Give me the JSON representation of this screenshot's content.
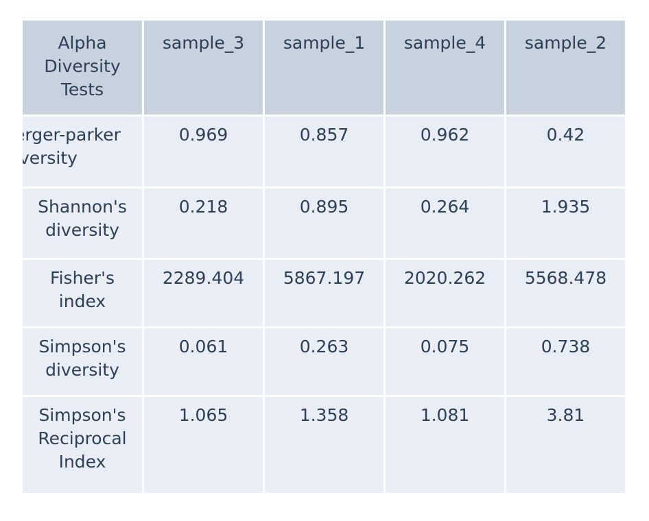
{
  "table": {
    "corner_header": "Alpha Diversity Tests",
    "columns": [
      "sample_3",
      "sample_1",
      "sample_4",
      "sample_2"
    ],
    "rows": [
      {
        "label": "berger-parker diversity",
        "label_rendered": "erger-parker iversity",
        "clipped": true,
        "values": [
          "0.969",
          "0.857",
          "0.962",
          "0.42"
        ]
      },
      {
        "label": "Shannon's diversity",
        "clipped": false,
        "values": [
          "0.218",
          "0.895",
          "0.264",
          "1.935"
        ]
      },
      {
        "label": "Fisher's index",
        "clipped": false,
        "values": [
          "2289.404",
          "5867.197",
          "2020.262",
          "5568.478"
        ]
      },
      {
        "label": "Simpson's diversity",
        "clipped": false,
        "values": [
          "0.061",
          "0.263",
          "0.075",
          "0.738"
        ]
      },
      {
        "label": "Simpson's Reciprocal Index",
        "clipped": false,
        "values": [
          "1.065",
          "1.358",
          "1.081",
          "3.81"
        ]
      }
    ]
  },
  "colors": {
    "header_bg": "#c8d2de",
    "cell_bg": "#e9edf5",
    "text": "#2e3f56",
    "page_bg": "#ffffff"
  },
  "chart_data": {
    "type": "table",
    "title": "Alpha Diversity Tests",
    "categories": [
      "sample_3",
      "sample_1",
      "sample_4",
      "sample_2"
    ],
    "series": [
      {
        "name": "berger-parker diversity",
        "values": [
          0.969,
          0.857,
          0.962,
          0.42
        ]
      },
      {
        "name": "Shannon's diversity",
        "values": [
          0.218,
          0.895,
          0.264,
          1.935
        ]
      },
      {
        "name": "Fisher's index",
        "values": [
          2289.404,
          5867.197,
          2020.262,
          5568.478
        ]
      },
      {
        "name": "Simpson's diversity",
        "values": [
          0.061,
          0.263,
          0.075,
          0.738
        ]
      },
      {
        "name": "Simpson's Reciprocal Index",
        "values": [
          1.065,
          1.358,
          1.081,
          3.81
        ]
      }
    ],
    "xlabel": "",
    "ylabel": "",
    "grid": true,
    "legend": "none"
  }
}
